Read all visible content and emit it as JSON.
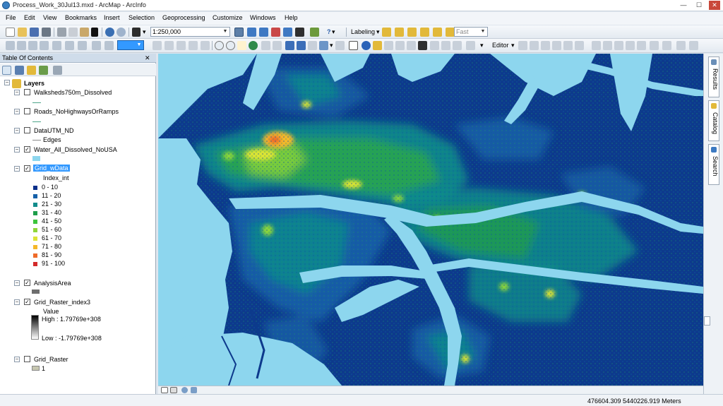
{
  "window": {
    "title": "Process_Work_30Jul13.mxd - ArcMap - ArcInfo",
    "minimize": "—",
    "maximize": "☐",
    "close": "✕"
  },
  "menubar": {
    "items": [
      "File",
      "Edit",
      "View",
      "Bookmarks",
      "Insert",
      "Selection",
      "Geoprocessing",
      "Customize",
      "Windows",
      "Help"
    ]
  },
  "toolbar": {
    "scale_value": "1:250,000",
    "labeling_label": "Labeling",
    "fast_value": "Fast",
    "editor_label": "Editor"
  },
  "toc": {
    "title": "Table Of Contents",
    "close": "✕",
    "root_label": "Layers",
    "layers": [
      {
        "label": "Walksheds750m_Dissolved",
        "checked": false
      },
      {
        "label": "Roads_NoHighwaysOrRamps",
        "checked": false
      },
      {
        "label": "DataUTM_ND",
        "checked": false,
        "sub": "Edges"
      },
      {
        "label": "Water_All_Dissolved_NoUSA",
        "checked": true
      },
      {
        "label": "Grid_wData",
        "checked": true,
        "field": "Index_int"
      },
      {
        "label": "AnalysisArea",
        "checked": true
      },
      {
        "label": "Grid_Raster_index3",
        "checked": true,
        "field": "Value"
      },
      {
        "label": "Grid_Raster",
        "checked": false
      }
    ],
    "classes": [
      {
        "label": "0 - 10",
        "color": "#0a2f8a"
      },
      {
        "label": "11 - 20",
        "color": "#1560a8"
      },
      {
        "label": "21 - 30",
        "color": "#128c8c"
      },
      {
        "label": "31 - 40",
        "color": "#1e9e4a"
      },
      {
        "label": "41 - 50",
        "color": "#3cc43c"
      },
      {
        "label": "51 - 60",
        "color": "#8fd63a"
      },
      {
        "label": "61 - 70",
        "color": "#dce336"
      },
      {
        "label": "71 - 80",
        "color": "#f5b82a"
      },
      {
        "label": "81 - 90",
        "color": "#ef6b2a"
      },
      {
        "label": "91 - 100",
        "color": "#d32a2a"
      }
    ],
    "raster_high": "High : 1.79769e+308",
    "raster_low": "Low : -1.79769e+308",
    "grid_raster_value": "1"
  },
  "dock": {
    "tabs": [
      "Results",
      "Catalog",
      "Search"
    ]
  },
  "status": {
    "coords": "476604.309  5440226.919 Meters"
  },
  "colors": {
    "water": "#8dd6ee",
    "land_base": "#0d3a8c",
    "selection": "#3399ff"
  }
}
